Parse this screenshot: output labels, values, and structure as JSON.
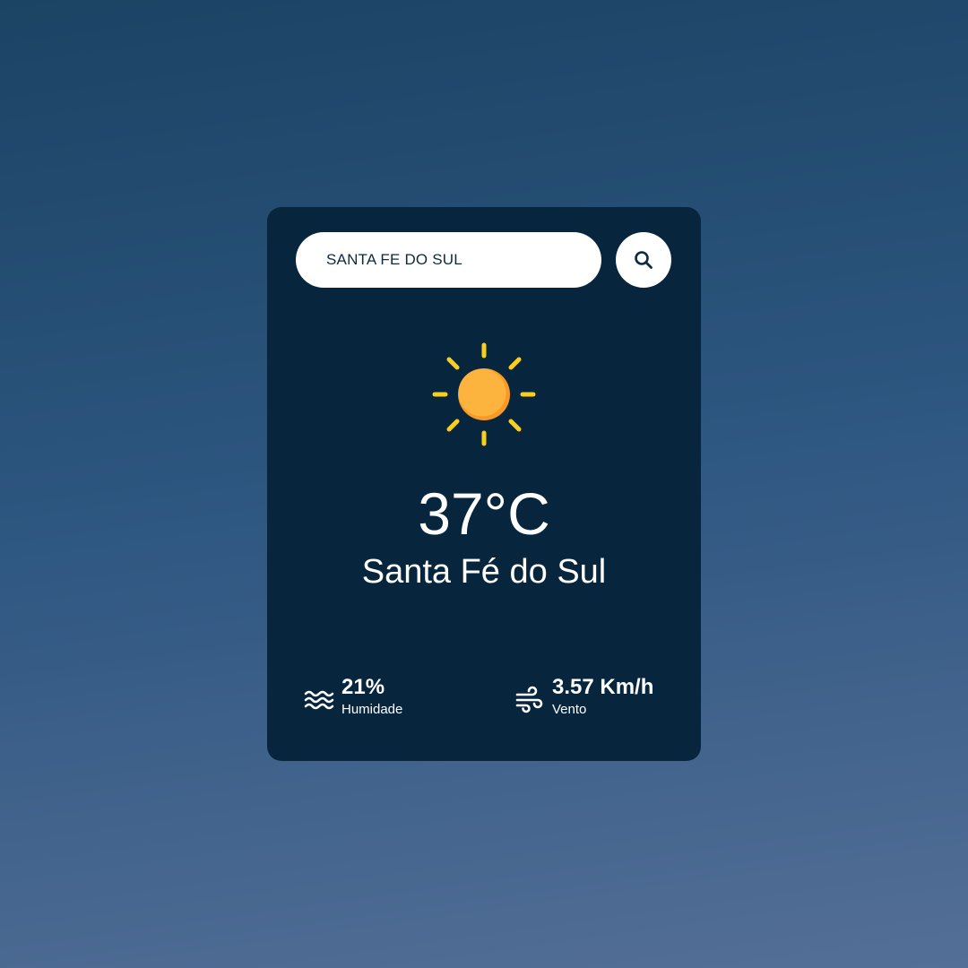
{
  "search": {
    "value": "SANTA FE DO SUL",
    "button_icon": "search-icon"
  },
  "weather": {
    "icon": "sun-icon",
    "temperature": "37°C",
    "city": "Santa Fé do Sul"
  },
  "details": {
    "humidity": {
      "icon": "waves-icon",
      "value": "21%",
      "label": "Humidade"
    },
    "wind": {
      "icon": "wind-icon",
      "value": "3.57 Km/h",
      "label": "Vento"
    }
  },
  "colors": {
    "card_background": "#07263d",
    "sun_core": "#fbab3c",
    "sun_rays": "#f9cf1b",
    "text": "#ffffff"
  }
}
